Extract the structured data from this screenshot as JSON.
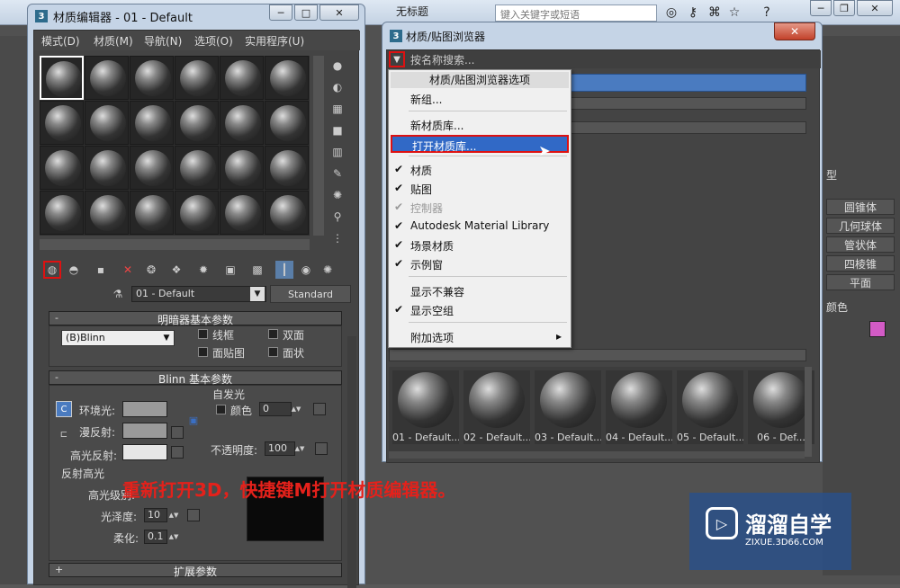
{
  "app": {
    "title": "无标题",
    "search_placeholder": "键入关键字或短语"
  },
  "material_editor": {
    "title": "材质编辑器 - 01 - Default",
    "menu": [
      "模式(D)",
      "材质(M)",
      "导航(N)",
      "选项(O)",
      "实用程序(U)"
    ],
    "current_material": "01 - Default",
    "material_type": "Standard",
    "rollouts": {
      "shader_basic": "明暗器基本参数",
      "blinn_basic": "Blinn 基本参数",
      "extended": "扩展参数"
    },
    "shader": "(B)Blinn",
    "shader_options": [
      "线框",
      "双面",
      "面贴图",
      "面状"
    ],
    "colors": {
      "ambient_label": "环境光:",
      "diffuse_label": "漫反射:",
      "specular_label": "高光反射:",
      "ambient": "#9a9a9a",
      "diffuse": "#9a9a9a",
      "specular": "#e6e6e6"
    },
    "self_illum": {
      "group": "自发光",
      "color_label": "颜色",
      "value": "0"
    },
    "opacity": {
      "label": "不透明度:",
      "value": "100"
    },
    "specular_highlights": {
      "group": "反射高光",
      "level_label": "高光级别:",
      "gloss_label": "光泽度:",
      "gloss_value": "10",
      "soften_label": "柔化:",
      "soften_value": "0.1"
    }
  },
  "material_browser": {
    "title": "材质/贴图浏览器",
    "search_label": "按名称搜索...",
    "swatches": [
      "01 - Default...",
      "02 - Default...",
      "03 - Default...",
      "04 - Default...",
      "05 - Default...",
      "06 - Def..."
    ]
  },
  "dropdown": {
    "header": "材质/贴图浏览器选项",
    "items": [
      {
        "label": "新组...",
        "checked": false,
        "enabled": true
      },
      {
        "label": "新材质库...",
        "checked": false,
        "enabled": true
      },
      {
        "label": "打开材质库...",
        "checked": false,
        "enabled": true,
        "highlighted": true
      },
      {
        "label": "材质",
        "checked": true,
        "enabled": true
      },
      {
        "label": "贴图",
        "checked": true,
        "enabled": true
      },
      {
        "label": "控制器",
        "checked": true,
        "enabled": false
      },
      {
        "label": "Autodesk Material Library",
        "checked": true,
        "enabled": true
      },
      {
        "label": "场景材质",
        "checked": true,
        "enabled": true
      },
      {
        "label": "示例窗",
        "checked": true,
        "enabled": true
      },
      {
        "label": "显示不兼容",
        "checked": false,
        "enabled": true
      },
      {
        "label": "显示空组",
        "checked": true,
        "enabled": true
      },
      {
        "label": "附加选项",
        "checked": false,
        "enabled": true,
        "submenu": true
      }
    ]
  },
  "command_panel": {
    "type_label": "型",
    "buttons": [
      "圆锥体",
      "几何球体",
      "管状体",
      "四棱锥",
      "平面"
    ],
    "color_label": "颜色",
    "color": "#d35bc6"
  },
  "caption": "重新打开3D，快捷键M打开材质编辑器。",
  "watermark": {
    "main": "溜溜自学",
    "sub": "ZIXUE.3D66.COM"
  }
}
